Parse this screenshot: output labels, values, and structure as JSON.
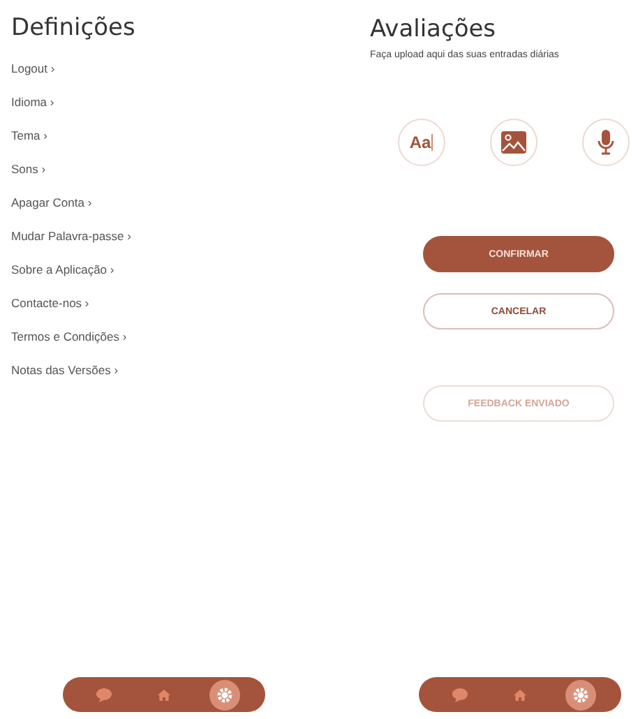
{
  "settings": {
    "title": "Definições",
    "items": [
      {
        "label": "Logout ›"
      },
      {
        "label": "Idioma ›"
      },
      {
        "label": "Tema ›"
      },
      {
        "label": "Sons ›"
      },
      {
        "label": "Apagar Conta ›"
      },
      {
        "label": "Mudar Palavra-passe ›"
      },
      {
        "label": "Sobre a Aplicação ›"
      },
      {
        "label": "Contacte-nos ›"
      },
      {
        "label": "Termos e Condições ›"
      },
      {
        "label": "Notas das Versões ›"
      }
    ],
    "nav": [
      {
        "kind": "chat",
        "selected": false
      },
      {
        "kind": "home",
        "selected": false
      },
      {
        "kind": "settings",
        "selected": true
      }
    ]
  },
  "reviews": {
    "title": "Avaliações",
    "subtitle": "Faça upload aqui das suas entradas diárias",
    "options": [
      {
        "kind": "text",
        "label": "Aa"
      },
      {
        "kind": "image"
      },
      {
        "kind": "audio"
      }
    ],
    "buttons": [
      {
        "label": "CONFIRMAR",
        "kind": "primary"
      },
      {
        "label": "CANCELAR",
        "kind": "outline"
      },
      {
        "label": "FEEDBACK ENVIADO",
        "kind": "muted"
      }
    ],
    "nav": [
      {
        "kind": "chat",
        "selected": false
      },
      {
        "kind": "home",
        "selected": false
      },
      {
        "kind": "settings",
        "selected": true
      }
    ]
  }
}
